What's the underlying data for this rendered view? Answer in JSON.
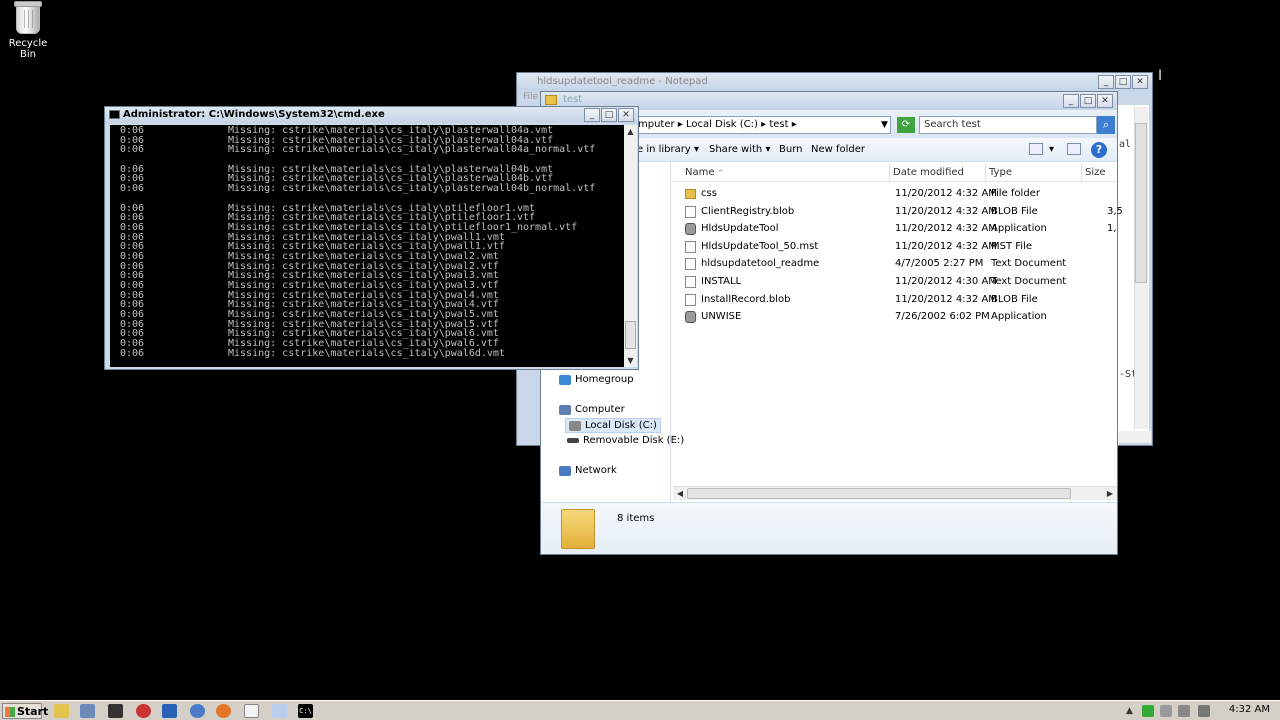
{
  "desktop": {
    "recycle_bin": "Recycle Bin"
  },
  "notepad": {
    "title": "hldsupdatetool_readme - Notepad",
    "menu": "File",
    "fragments": [
      "al",
      "-St"
    ]
  },
  "explorer": {
    "title": "test",
    "breadcrumb": [
      "mputer",
      "Local Disk (C:)",
      "test"
    ],
    "search_placeholder": "Search test",
    "toolbar": {
      "include": "e in library",
      "share": "Share with",
      "burn": "Burn",
      "new_folder": "New folder"
    },
    "nav": [
      {
        "label": "Homegroup",
        "icon": "homegroup-icon"
      },
      {
        "label": "Computer",
        "icon": "computer-icon"
      },
      {
        "label": "Local Disk (C:)",
        "icon": "drive-icon",
        "selected": true
      },
      {
        "label": "Removable Disk (E:)",
        "icon": "removable-drive-icon"
      },
      {
        "label": "Network",
        "icon": "network-icon"
      }
    ],
    "columns": [
      "Name",
      "Date modified",
      "Type",
      "Size"
    ],
    "files": [
      {
        "name": "css",
        "date": "11/20/2012 4:32 AM",
        "type": "File folder",
        "size": "",
        "icon": "folder"
      },
      {
        "name": "ClientRegistry.blob",
        "date": "11/20/2012 4:32 AM",
        "type": "BLOB File",
        "size": "3,5",
        "icon": "file"
      },
      {
        "name": "HldsUpdateTool",
        "date": "11/20/2012 4:32 AM",
        "type": "Application",
        "size": "1,",
        "icon": "app"
      },
      {
        "name": "HldsUpdateTool_50.mst",
        "date": "11/20/2012 4:32 AM",
        "type": "MST File",
        "size": "",
        "icon": "file"
      },
      {
        "name": "hldsupdatetool_readme",
        "date": "4/7/2005 2:27 PM",
        "type": "Text Document",
        "size": "",
        "icon": "file"
      },
      {
        "name": "INSTALL",
        "date": "11/20/2012 4:30 AM",
        "type": "Text Document",
        "size": "",
        "icon": "file"
      },
      {
        "name": "InstallRecord.blob",
        "date": "11/20/2012 4:32 AM",
        "type": "BLOB File",
        "size": "",
        "icon": "file"
      },
      {
        "name": "UNWISE",
        "date": "7/26/2002 6:02 PM",
        "type": "Application",
        "size": "",
        "icon": "app"
      }
    ],
    "item_count": "8 items"
  },
  "cmd": {
    "title": "Administrator: C:\\Windows\\System32\\cmd.exe",
    "lines": [
      {
        "time": "0:06",
        "text": "Missing: cstrike\\materials\\cs_italy\\plasterwall04a.vmt"
      },
      {
        "time": "0:06",
        "text": "Missing: cstrike\\materials\\cs_italy\\plasterwall04a.vtf"
      },
      {
        "time": "0:06",
        "text": "Missing: cstrike\\materials\\cs_italy\\plasterwall04a_normal.vtf"
      },
      {
        "time": "",
        "text": ""
      },
      {
        "time": "0:06",
        "text": "Missing: cstrike\\materials\\cs_italy\\plasterwall04b.vmt"
      },
      {
        "time": "0:06",
        "text": "Missing: cstrike\\materials\\cs_italy\\plasterwall04b.vtf"
      },
      {
        "time": "0:06",
        "text": "Missing: cstrike\\materials\\cs_italy\\plasterwall04b_normal.vtf"
      },
      {
        "time": "",
        "text": ""
      },
      {
        "time": "0:06",
        "text": "Missing: cstrike\\materials\\cs_italy\\ptilefloor1.vmt"
      },
      {
        "time": "0:06",
        "text": "Missing: cstrike\\materials\\cs_italy\\ptilefloor1.vtf"
      },
      {
        "time": "0:06",
        "text": "Missing: cstrike\\materials\\cs_italy\\ptilefloor1_normal.vtf"
      },
      {
        "time": "0:06",
        "text": "Missing: cstrike\\materials\\cs_italy\\pwall1.vmt"
      },
      {
        "time": "0:06",
        "text": "Missing: cstrike\\materials\\cs_italy\\pwall1.vtf"
      },
      {
        "time": "0:06",
        "text": "Missing: cstrike\\materials\\cs_italy\\pwal2.vmt"
      },
      {
        "time": "0:06",
        "text": "Missing: cstrike\\materials\\cs_italy\\pwal2.vtf"
      },
      {
        "time": "0:06",
        "text": "Missing: cstrike\\materials\\cs_italy\\pwal3.vmt"
      },
      {
        "time": "0:06",
        "text": "Missing: cstrike\\materials\\cs_italy\\pwal3.vtf"
      },
      {
        "time": "0:06",
        "text": "Missing: cstrike\\materials\\cs_italy\\pwal4.vmt"
      },
      {
        "time": "0:06",
        "text": "Missing: cstrike\\materials\\cs_italy\\pwal4.vtf"
      },
      {
        "time": "0:06",
        "text": "Missing: cstrike\\materials\\cs_italy\\pwal5.vmt"
      },
      {
        "time": "0:06",
        "text": "Missing: cstrike\\materials\\cs_italy\\pwal5.vtf"
      },
      {
        "time": "0:06",
        "text": "Missing: cstrike\\materials\\cs_italy\\pwal6.vmt"
      },
      {
        "time": "0:06",
        "text": "Missing: cstrike\\materials\\cs_italy\\pwal6.vtf"
      },
      {
        "time": "0:06",
        "text": "Missing: cstrike\\materials\\cs_italy\\pwal6d.vmt"
      }
    ]
  },
  "taskbar": {
    "start": "Start",
    "clock": "4:32 AM",
    "cmd_button": "C:\\"
  }
}
